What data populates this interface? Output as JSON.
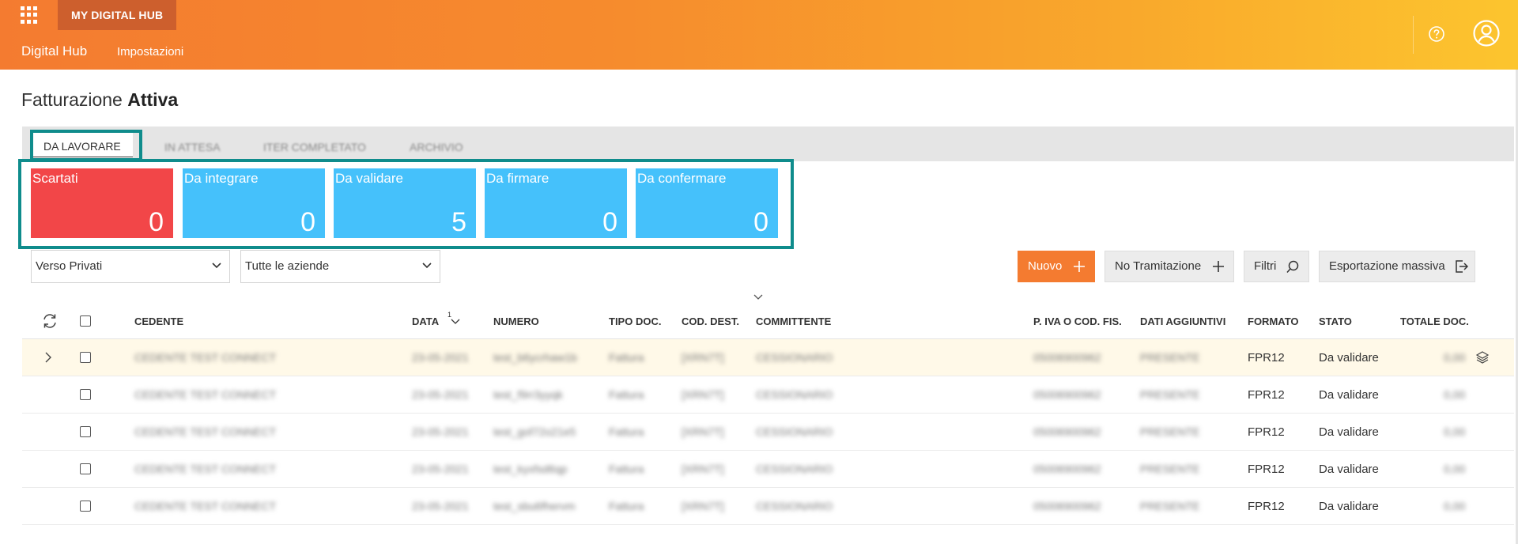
{
  "header": {
    "brand": "MY DIGITAL HUB",
    "nav": [
      "Digital Hub",
      "Impostazioni"
    ],
    "icons": [
      "apps-grid-icon",
      "help-icon",
      "user-icon"
    ]
  },
  "page": {
    "title_light": "Fatturazione",
    "title_bold": "Attiva"
  },
  "tabs": [
    {
      "label": "DA LAVORARE",
      "active": true
    },
    {
      "label": "IN ATTESA",
      "active": false
    },
    {
      "label": "ITER COMPLETATO",
      "active": false
    },
    {
      "label": "ARCHIVIO",
      "active": false
    }
  ],
  "cards": [
    {
      "label": "Scartati",
      "count": "0",
      "color": "#f24648"
    },
    {
      "label": "Da integrare",
      "count": "0",
      "color": "#45c1fb"
    },
    {
      "label": "Da validare",
      "count": "5",
      "color": "#45c1fb"
    },
    {
      "label": "Da firmare",
      "count": "0",
      "color": "#45c1fb"
    },
    {
      "label": "Da confermare",
      "count": "0",
      "color": "#45c1fb"
    }
  ],
  "filters": {
    "verso": "Verso Privati",
    "aziende": "Tutte le aziende"
  },
  "actions": {
    "nuovo": "Nuovo",
    "no_tramitazione": "No Tramitazione",
    "filtri": "Filtri",
    "esportazione": "Esportazione massiva"
  },
  "table": {
    "columns": {
      "cedente": "CEDENTE",
      "data": "DATA",
      "numero": "NUMERO",
      "tipo_doc": "TIPO DOC.",
      "cod_dest": "COD. DEST.",
      "committente": "COMMITTENTE",
      "piva": "P. IVA O COD. FIS.",
      "dati_aggiuntivi": "DATI AGGIUNTIVI",
      "formato": "FORMATO",
      "stato": "STATO",
      "totale": "TOTALE DOC."
    },
    "sort_index": "1",
    "rows": [
      {
        "cedente": "CEDENTE TEST CONNECT",
        "data": "23-05-2021",
        "numero": "test_b6ycrhaw1b",
        "tipo": "Fattura",
        "cod_dest": "[XRN7T]",
        "committente": "CESSIONARIO",
        "piva": "05006900962",
        "dati": "PRESENTE",
        "formato": "FPR12",
        "stato": "Da validare",
        "totale": "0,00",
        "selected": true
      },
      {
        "cedente": "CEDENTE TEST CONNECT",
        "data": "23-05-2021",
        "numero": "test_f9rr3yyqk",
        "tipo": "Fattura",
        "cod_dest": "[XRN7T]",
        "committente": "CESSIONARIO",
        "piva": "05006900962",
        "dati": "PRESENTE",
        "formato": "FPR12",
        "stato": "Da validare",
        "totale": "0,00",
        "selected": false
      },
      {
        "cedente": "CEDENTE TEST CONNECT",
        "data": "23-05-2021",
        "numero": "test_gof72o21e5",
        "tipo": "Fattura",
        "cod_dest": "[XRN7T]",
        "committente": "CESSIONARIO",
        "piva": "05006900962",
        "dati": "PRESENTE",
        "formato": "FPR12",
        "stato": "Da validare",
        "totale": "0,00",
        "selected": false
      },
      {
        "cedente": "CEDENTE TEST CONNECT",
        "data": "23-05-2021",
        "numero": "test_kyxfsd6qp",
        "tipo": "Fattura",
        "cod_dest": "[XRN7T]",
        "committente": "CESSIONARIO",
        "piva": "05006900962",
        "dati": "PRESENTE",
        "formato": "FPR12",
        "stato": "Da validare",
        "totale": "0,00",
        "selected": false
      },
      {
        "cedente": "CEDENTE TEST CONNECT",
        "data": "23-05-2021",
        "numero": "test_sbu6fhervm",
        "tipo": "Fattura",
        "cod_dest": "[XRN7T]",
        "committente": "CESSIONARIO",
        "piva": "05006900962",
        "dati": "PRESENTE",
        "formato": "FPR12",
        "stato": "Da validare",
        "totale": "0,00",
        "selected": false
      }
    ]
  },
  "colors": {
    "header_start": "#f47b30",
    "header_end": "#fcc52e",
    "accent": "#f47b30",
    "highlight": "#0f8c8c",
    "card_red": "#f24648",
    "card_blue": "#45c1fb"
  }
}
